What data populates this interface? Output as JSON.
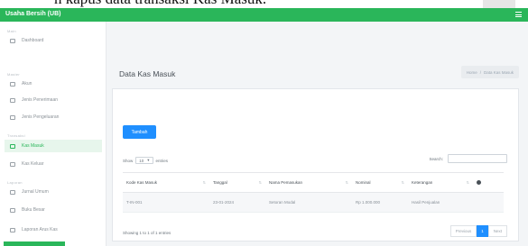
{
  "caption": {
    "text": "n kapus data transaksi Kas Masuk."
  },
  "topbar": {
    "brand": "Usaha Bersih (UB)"
  },
  "sidebar": {
    "sections": [
      {
        "heading": "Main",
        "items": [
          {
            "label": "Dashboard",
            "icon": "home-icon"
          }
        ]
      },
      {
        "heading": "Master",
        "items": [
          {
            "label": "Akun",
            "icon": "calendar-icon"
          },
          {
            "label": "Jenis Penerimaan",
            "icon": "document-icon"
          },
          {
            "label": "Jenis Pengeluaran",
            "icon": "list-icon"
          }
        ]
      },
      {
        "heading": "Transaksi",
        "items": [
          {
            "label": "Kas Masuk",
            "icon": "wallet-icon",
            "active": true
          },
          {
            "label": "Kas Keluar",
            "icon": "table-icon"
          }
        ]
      },
      {
        "heading": "Laporan",
        "items": [
          {
            "label": "Jurnal Umum",
            "icon": "file-icon"
          },
          {
            "label": "Buku Besar",
            "icon": "grid-icon"
          },
          {
            "label": "Laporan Arus Kas",
            "icon": "report-icon"
          }
        ]
      }
    ]
  },
  "page": {
    "title": "Data Kas Masuk",
    "breadcrumb": {
      "home": "Home",
      "separator": "/",
      "current": "Data Kas Masuk"
    }
  },
  "toolbar": {
    "add_label": "Tambah"
  },
  "table_controls": {
    "show": "Show",
    "entries_value": "10",
    "entries": "entries",
    "search": "Search:"
  },
  "table": {
    "headers": [
      "Kode Kas Masuk",
      "Tanggal",
      "Nama Pemasukan",
      "Nominal",
      "Keterangan"
    ],
    "rows": [
      [
        "T-IN-001",
        "23-01-2024",
        "Setoran Modal",
        "Rp 1.000.000",
        "Hasil Penjualan"
      ]
    ]
  },
  "footer": {
    "info": "Showing 1 to 1 of 1 entries",
    "previous": "Previous",
    "page": "1",
    "next": "Next"
  },
  "colors": {
    "brand_green": "#2ab65a",
    "primary_blue": "#1f8fff"
  }
}
